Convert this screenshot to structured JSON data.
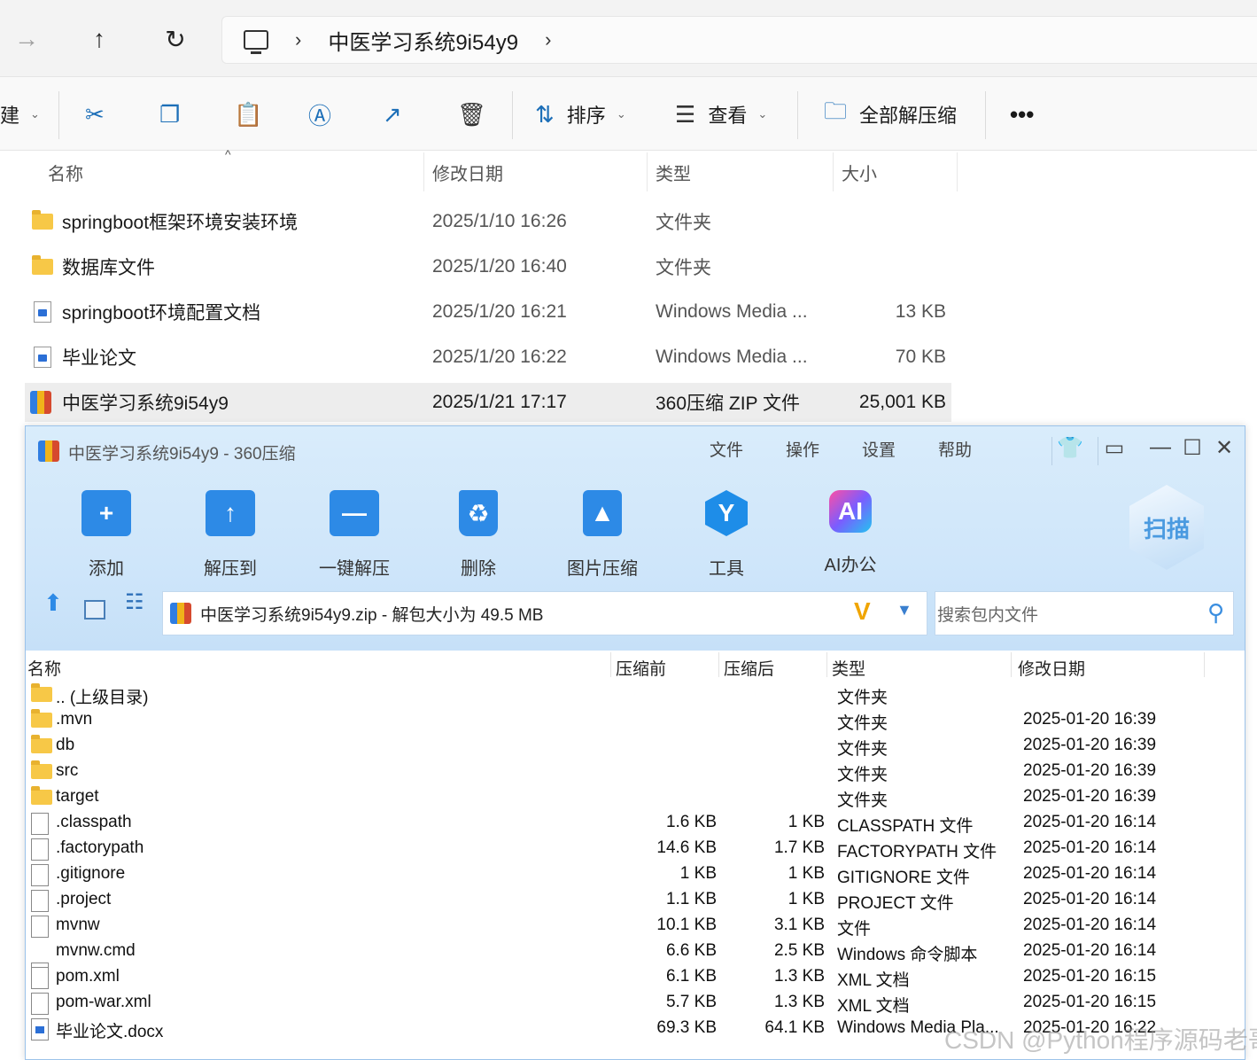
{
  "explorer": {
    "address": {
      "segment": "中医学习系统9i54y9"
    },
    "commands": {
      "new_partial": "建",
      "sort": "排序",
      "view": "查看",
      "extract_all": "全部解压缩"
    },
    "columns": {
      "name": "名称",
      "modified": "修改日期",
      "type": "类型",
      "size": "大小"
    },
    "rows": [
      {
        "name": "springboot框架环境安装环境",
        "modified": "2025/1/10 16:26",
        "type": "文件夹",
        "size": ""
      },
      {
        "name": "数据库文件",
        "modified": "2025/1/20 16:40",
        "type": "文件夹",
        "size": ""
      },
      {
        "name": "springboot环境配置文档",
        "modified": "2025/1/20 16:21",
        "type": "Windows Media ...",
        "size": "13 KB"
      },
      {
        "name": "毕业论文",
        "modified": "2025/1/20 16:22",
        "type": "Windows Media ...",
        "size": "70 KB"
      },
      {
        "name": "中医学习系统9i54y9",
        "modified": "2025/1/21 17:17",
        "type": "360压缩 ZIP 文件",
        "size": "25,001 KB"
      }
    ]
  },
  "zip360": {
    "title": "中医学习系统9i54y9 - 360压缩",
    "menu": [
      "文件",
      "操作",
      "设置",
      "帮助"
    ],
    "tools": [
      "添加",
      "解压到",
      "一键解压",
      "删除",
      "图片压缩",
      "工具",
      "AI办公"
    ],
    "scan_label": "扫描",
    "path_text": "中医学习系统9i54y9.zip - 解包大小为 49.5 MB",
    "search_placeholder": "搜索包内文件",
    "columns": {
      "name": "名称",
      "before": "压缩前",
      "after": "压缩后",
      "type": "类型",
      "modified": "修改日期"
    },
    "rows": [
      {
        "name": ".. (上级目录)",
        "before": "",
        "after": "",
        "type": "文件夹",
        "modified": "",
        "icon": "folder"
      },
      {
        "name": ".mvn",
        "before": "",
        "after": "",
        "type": "文件夹",
        "modified": "2025-01-20 16:39",
        "icon": "folder"
      },
      {
        "name": "db",
        "before": "",
        "after": "",
        "type": "文件夹",
        "modified": "2025-01-20 16:39",
        "icon": "folder"
      },
      {
        "name": "src",
        "before": "",
        "after": "",
        "type": "文件夹",
        "modified": "2025-01-20 16:39",
        "icon": "folder"
      },
      {
        "name": "target",
        "before": "",
        "after": "",
        "type": "文件夹",
        "modified": "2025-01-20 16:39",
        "icon": "folder"
      },
      {
        "name": ".classpath",
        "before": "1.6 KB",
        "after": "1 KB",
        "type": "CLASSPATH 文件",
        "modified": "2025-01-20 16:14",
        "icon": "file"
      },
      {
        "name": ".factorypath",
        "before": "14.6 KB",
        "after": "1.7 KB",
        "type": "FACTORYPATH 文件",
        "modified": "2025-01-20 16:14",
        "icon": "file"
      },
      {
        "name": ".gitignore",
        "before": "1 KB",
        "after": "1 KB",
        "type": "GITIGNORE 文件",
        "modified": "2025-01-20 16:14",
        "icon": "file"
      },
      {
        "name": ".project",
        "before": "1.1 KB",
        "after": "1 KB",
        "type": "PROJECT 文件",
        "modified": "2025-01-20 16:14",
        "icon": "file"
      },
      {
        "name": "mvnw",
        "before": "10.1 KB",
        "after": "3.1 KB",
        "type": "文件",
        "modified": "2025-01-20 16:14",
        "icon": "file"
      },
      {
        "name": "mvnw.cmd",
        "before": "6.6 KB",
        "after": "2.5 KB",
        "type": "Windows 命令脚本",
        "modified": "2025-01-20 16:14",
        "icon": "cmd"
      },
      {
        "name": "pom.xml",
        "before": "6.1 KB",
        "after": "1.3 KB",
        "type": "XML 文档",
        "modified": "2025-01-20 16:15",
        "icon": "file"
      },
      {
        "name": "pom-war.xml",
        "before": "5.7 KB",
        "after": "1.3 KB",
        "type": "XML 文档",
        "modified": "2025-01-20 16:15",
        "icon": "file"
      },
      {
        "name": "毕业论文.docx",
        "before": "69.3 KB",
        "after": "64.1 KB",
        "type": "Windows Media Pla...",
        "modified": "2025-01-20 16:22",
        "icon": "word"
      }
    ]
  },
  "watermark": "CSDN @Python程序源码老哥",
  "colors": {
    "accent": "#1d6fb8",
    "zip_header": "#d9ecfb",
    "selected_row": "#ededed"
  }
}
